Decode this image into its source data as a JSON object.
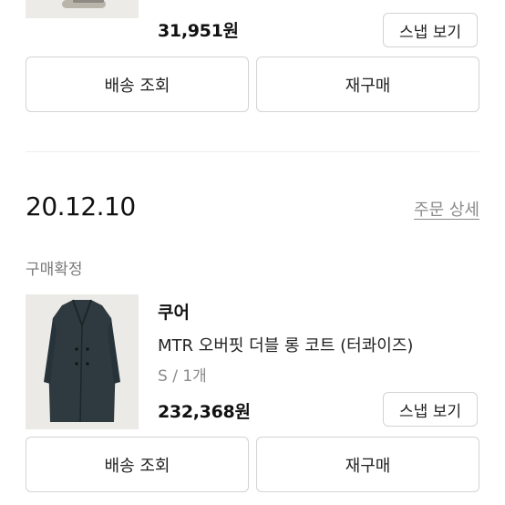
{
  "order1": {
    "price": "31,951원",
    "snap_button": "스냅 보기",
    "track_button": "배송 조회",
    "reorder_button": "재구매"
  },
  "order2": {
    "date": "20.12.10",
    "detail_link": "주문 상세",
    "status": "구매확정",
    "brand": "쿠어",
    "product_name": "MTR 오버핏 더블 롱 코트 (터콰이즈)",
    "option": "S / 1개",
    "price": "232,368원",
    "snap_button": "스냅 보기",
    "track_button": "배송 조회",
    "reorder_button": "재구매"
  },
  "colors": {
    "coat": "#2e3a3f",
    "border": "#d3d3d3",
    "muted_text": "#8a8a8a"
  }
}
